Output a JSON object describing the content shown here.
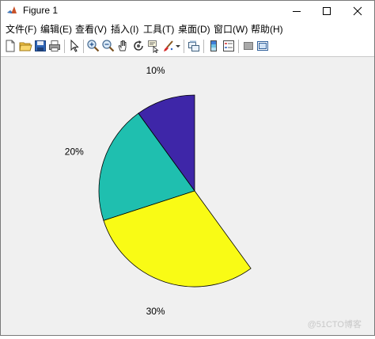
{
  "window": {
    "title": "Figure 1"
  },
  "menu": {
    "items": [
      "文件(F)",
      "编辑(E)",
      "查看(V)",
      "插入(I)",
      "工具(T)",
      "桌面(D)",
      "窗口(W)",
      "帮助(H)"
    ]
  },
  "toolbar": {
    "icons": [
      "new-figure-icon",
      "open-file-icon",
      "save-icon",
      "print-icon",
      "edit-plot-arrow-icon",
      "zoom-in-icon",
      "zoom-out-icon",
      "pan-hand-icon",
      "rotate-3d-icon",
      "data-cursor-icon",
      "brush-icon",
      "brush-dropdown-icon",
      "link-plot-icon",
      "colorbar-icon",
      "legend-icon",
      "hide-plot-tools-icon",
      "show-plot-tools-icon"
    ]
  },
  "chart_data": {
    "type": "pie",
    "slices": [
      {
        "label": "10%",
        "value": 10,
        "color": "#3e26a8"
      },
      {
        "label": "20%",
        "value": 20,
        "color": "#1fbfaf"
      },
      {
        "label": "30%",
        "value": 30,
        "color": "#f9fb15"
      }
    ],
    "partial_pie": true,
    "start": "12 o'clock, counterclockwise",
    "edge_color": "#000000"
  },
  "watermark": "@51CTO博客"
}
